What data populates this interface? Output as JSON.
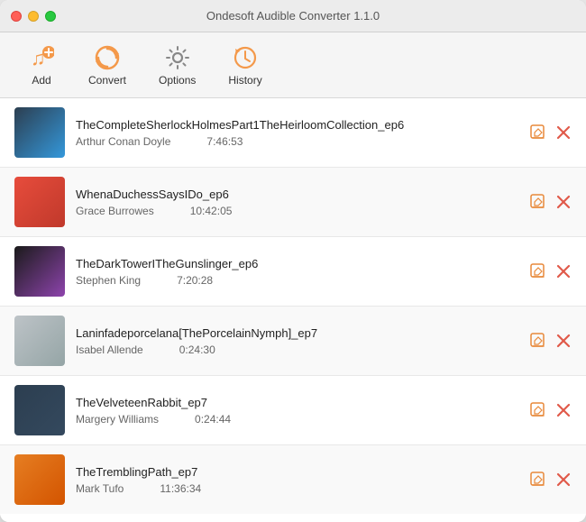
{
  "window": {
    "title": "Ondesoft Audible Converter 1.1.0"
  },
  "toolbar": {
    "add_label": "Add",
    "convert_label": "Convert",
    "options_label": "Options",
    "history_label": "History"
  },
  "items": [
    {
      "id": 1,
      "title": "TheCompleteSherlockHolmesPart1TheHeirloomCollection_ep6",
      "author": "Arthur Conan Doyle",
      "duration": "7:46:53",
      "cover_color": "cover-1"
    },
    {
      "id": 2,
      "title": "WhenaDuchessSaysIDo_ep6",
      "author": "Grace Burrowes",
      "duration": "10:42:05",
      "cover_color": "cover-2"
    },
    {
      "id": 3,
      "title": "TheDarkTowerITheGunslinger_ep6",
      "author": "Stephen King",
      "duration": "7:20:28",
      "cover_color": "cover-3"
    },
    {
      "id": 4,
      "title": "Laninfadeporcelana[ThePorcelainNymph]_ep7",
      "author": "Isabel Allende",
      "duration": "0:24:30",
      "cover_color": "cover-4"
    },
    {
      "id": 5,
      "title": "TheVelveteenRabbit_ep7",
      "author": "Margery Williams",
      "duration": "0:24:44",
      "cover_color": "cover-5"
    },
    {
      "id": 6,
      "title": "TheTremblingPath_ep7",
      "author": "Mark Tufo",
      "duration": "11:36:34",
      "cover_color": "cover-6"
    }
  ]
}
